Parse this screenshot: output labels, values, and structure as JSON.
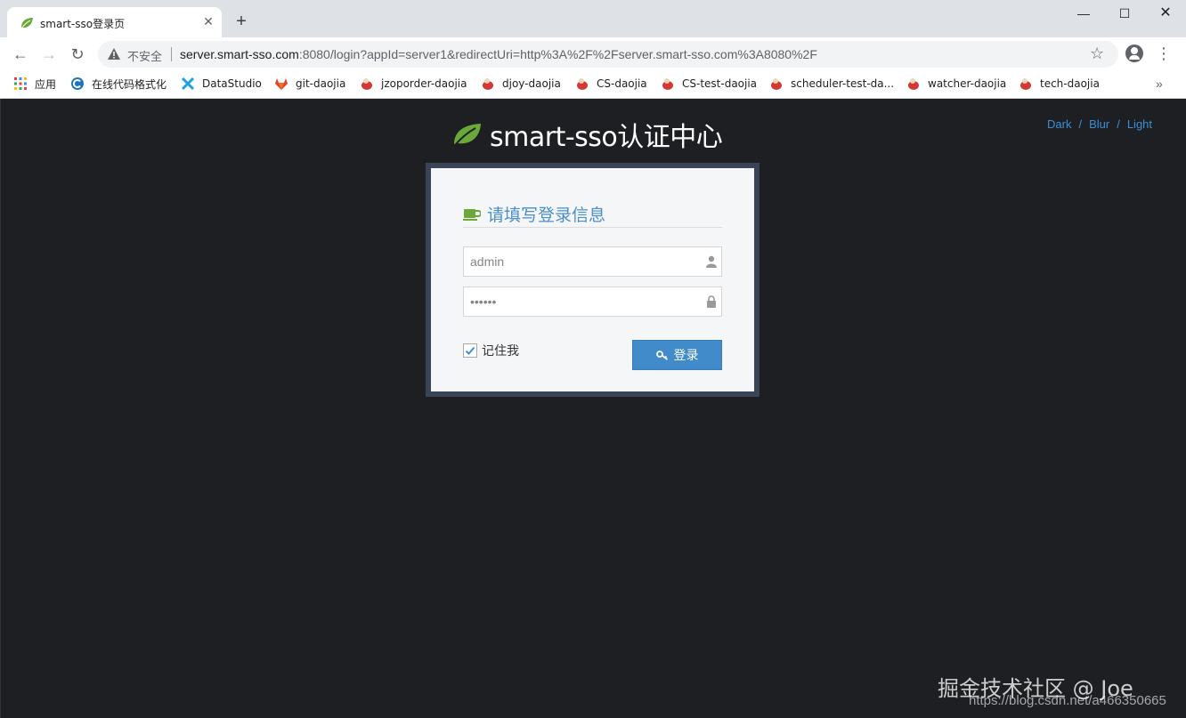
{
  "browser": {
    "tab": {
      "title": "smart-sso登录页",
      "close": "✕"
    },
    "new_tab": "+",
    "window": {
      "minimize": "—",
      "maximize": "☐",
      "close": "✕"
    },
    "nav": {
      "back": "←",
      "forward": "→",
      "reload": "↻"
    },
    "omnibox": {
      "security_label": "不安全",
      "url_host": "server.smart-sso.com",
      "url_rest": ":8080/login?appId=server1&redirectUri=http%3A%2F%2Fserver.smart-sso.com%3A8080%2F"
    },
    "star": "☆",
    "menu": "⋮",
    "bookmarks": [
      {
        "label": "应用",
        "icon": "apps-grid-icon"
      },
      {
        "label": "在线代码格式化",
        "icon": "c-logo-icon"
      },
      {
        "label": "DataStudio",
        "icon": "datastudio-icon"
      },
      {
        "label": "git-daojia",
        "icon": "gitlab-icon"
      },
      {
        "label": "jzoporder-daojia",
        "icon": "jenkins-icon"
      },
      {
        "label": "djoy-daojia",
        "icon": "jenkins-icon"
      },
      {
        "label": "CS-daojia",
        "icon": "jenkins-icon"
      },
      {
        "label": "CS-test-daojia",
        "icon": "jenkins-icon"
      },
      {
        "label": "scheduler-test-da...",
        "icon": "jenkins-icon"
      },
      {
        "label": "watcher-daojia",
        "icon": "jenkins-icon"
      },
      {
        "label": "tech-daojia",
        "icon": "jenkins-icon"
      }
    ],
    "bookmarks_more": "»"
  },
  "page": {
    "brand_title": "smart-sso认证中心",
    "themes": {
      "dark": "Dark",
      "blur": "Blur",
      "light": "Light",
      "separator": "/"
    },
    "login": {
      "heading": "请填写登录信息",
      "username_value": "admin",
      "password_value": "••••••",
      "remember_label": "记住我",
      "remember_checked": true,
      "submit_label": "登录"
    },
    "watermark": "掘金技术社区 @ Joe",
    "watermark_url": "https://blog.csdn.net/a466350665"
  },
  "colors": {
    "page_bg": "#1d1f22",
    "frame": "#394557",
    "accent_blue": "#428bca",
    "leaf_green": "#6aa83a"
  }
}
